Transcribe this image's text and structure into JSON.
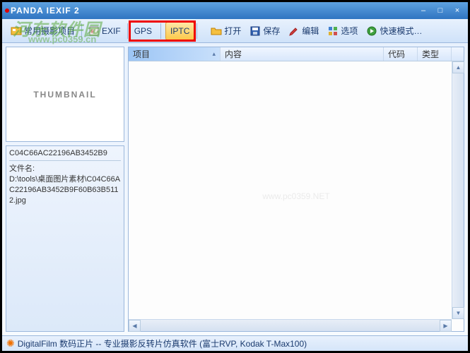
{
  "titlebar": {
    "app_name": "PANDA IEXIF 2"
  },
  "toolbar": {
    "common_items": "常用摄影项目",
    "exif": "EXIF",
    "gps": "GPS",
    "iptc": "IPTC",
    "open": "打开",
    "save": "保存",
    "edit": "编辑",
    "options": "选项",
    "quick_mode": "快速模式…"
  },
  "left": {
    "thumbnail_label": "THUMBNAIL",
    "info_title": "C04C66AC22196AB3452B9",
    "filename_label": "文件名:",
    "file_path": "D:\\tools\\桌面图片素材\\C04C66AC22196AB3452B9F60B63B5112.jpg"
  },
  "grid": {
    "col_item": "项目",
    "col_content": "内容",
    "col_code": "代码",
    "col_type": "类型"
  },
  "statusbar": {
    "ad_text": "DigitalFilm 数码正片 -- 专业摄影反转片仿真软件 (富士RVP, Kodak T-Max100)"
  },
  "watermark": {
    "site_name": "河东软件园",
    "site_url": "www.pc0359.cn",
    "grid_mark": "www.pc0359.NET"
  }
}
